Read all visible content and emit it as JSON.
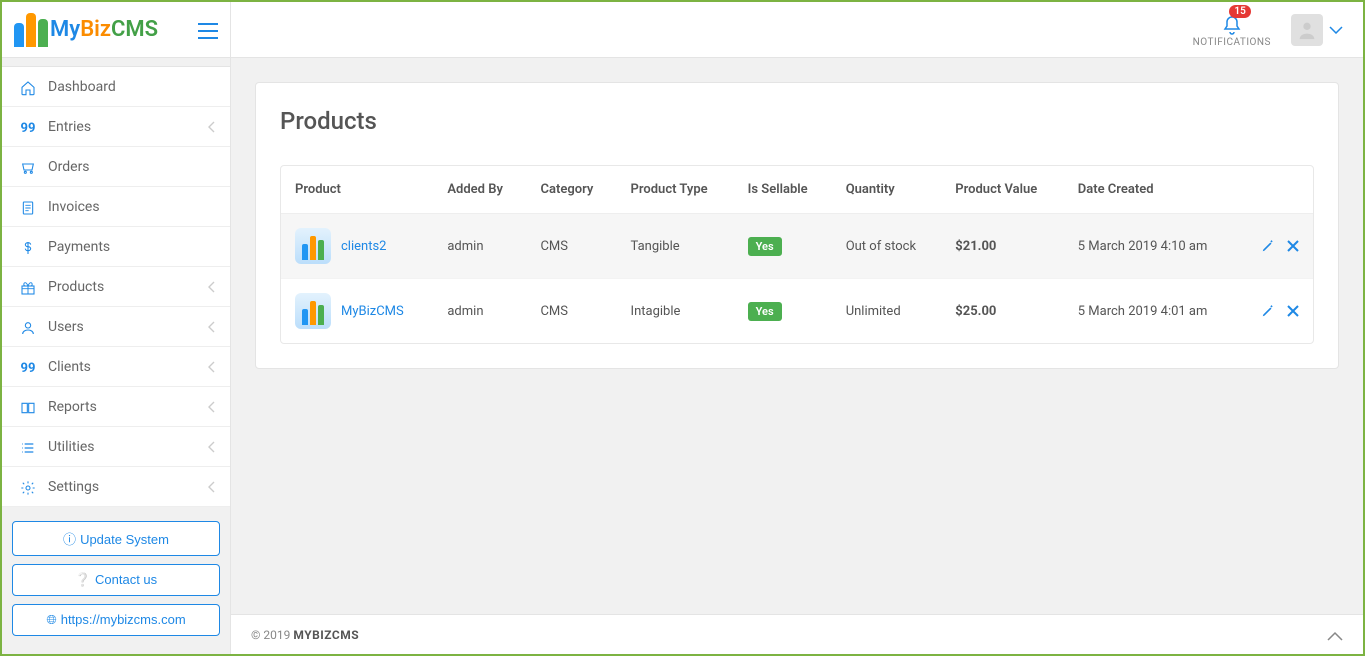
{
  "logo": {
    "my": "My",
    "biz": "Biz",
    "cms": "CMS"
  },
  "topbar": {
    "notifications_label": "NOTIFICATIONS",
    "notifications_count": "15"
  },
  "sidebar": {
    "items": [
      {
        "icon": "home",
        "label": "Dashboard",
        "expandable": false
      },
      {
        "icon": "99",
        "label": "Entries",
        "expandable": true
      },
      {
        "icon": "cart",
        "label": "Orders",
        "expandable": false
      },
      {
        "icon": "doc",
        "label": "Invoices",
        "expandable": false
      },
      {
        "icon": "dollar",
        "label": "Payments",
        "expandable": false
      },
      {
        "icon": "gift",
        "label": "Products",
        "expandable": true
      },
      {
        "icon": "user",
        "label": "Users",
        "expandable": true
      },
      {
        "icon": "99",
        "label": "Clients",
        "expandable": true
      },
      {
        "icon": "book",
        "label": "Reports",
        "expandable": true
      },
      {
        "icon": "list",
        "label": "Utilities",
        "expandable": true
      },
      {
        "icon": "gear",
        "label": "Settings",
        "expandable": true
      }
    ],
    "buttons": {
      "update": "Update System",
      "contact": "Contact us",
      "site": "https://mybizcms.com"
    }
  },
  "page": {
    "title": "Products",
    "table": {
      "headers": [
        "Product",
        "Added By",
        "Category",
        "Product Type",
        "Is Sellable",
        "Quantity",
        "Product Value",
        "Date Created",
        ""
      ],
      "rows": [
        {
          "product": "clients2",
          "added_by": "admin",
          "category": "CMS",
          "type": "Tangible",
          "sellable": "Yes",
          "quantity": "Out of stock",
          "quantity_class": "out-stock",
          "value": "$21.00",
          "date": "5 March 2019 4:10 am"
        },
        {
          "product": "MyBizCMS",
          "added_by": "admin",
          "category": "CMS",
          "type": "Intagible",
          "sellable": "Yes",
          "quantity": "Unlimited",
          "quantity_class": "",
          "value": "$25.00",
          "date": "5 March 2019 4:01 am"
        }
      ]
    }
  },
  "footer": {
    "copyright": "© 2019 ",
    "brand": "MYBIZCMS"
  }
}
